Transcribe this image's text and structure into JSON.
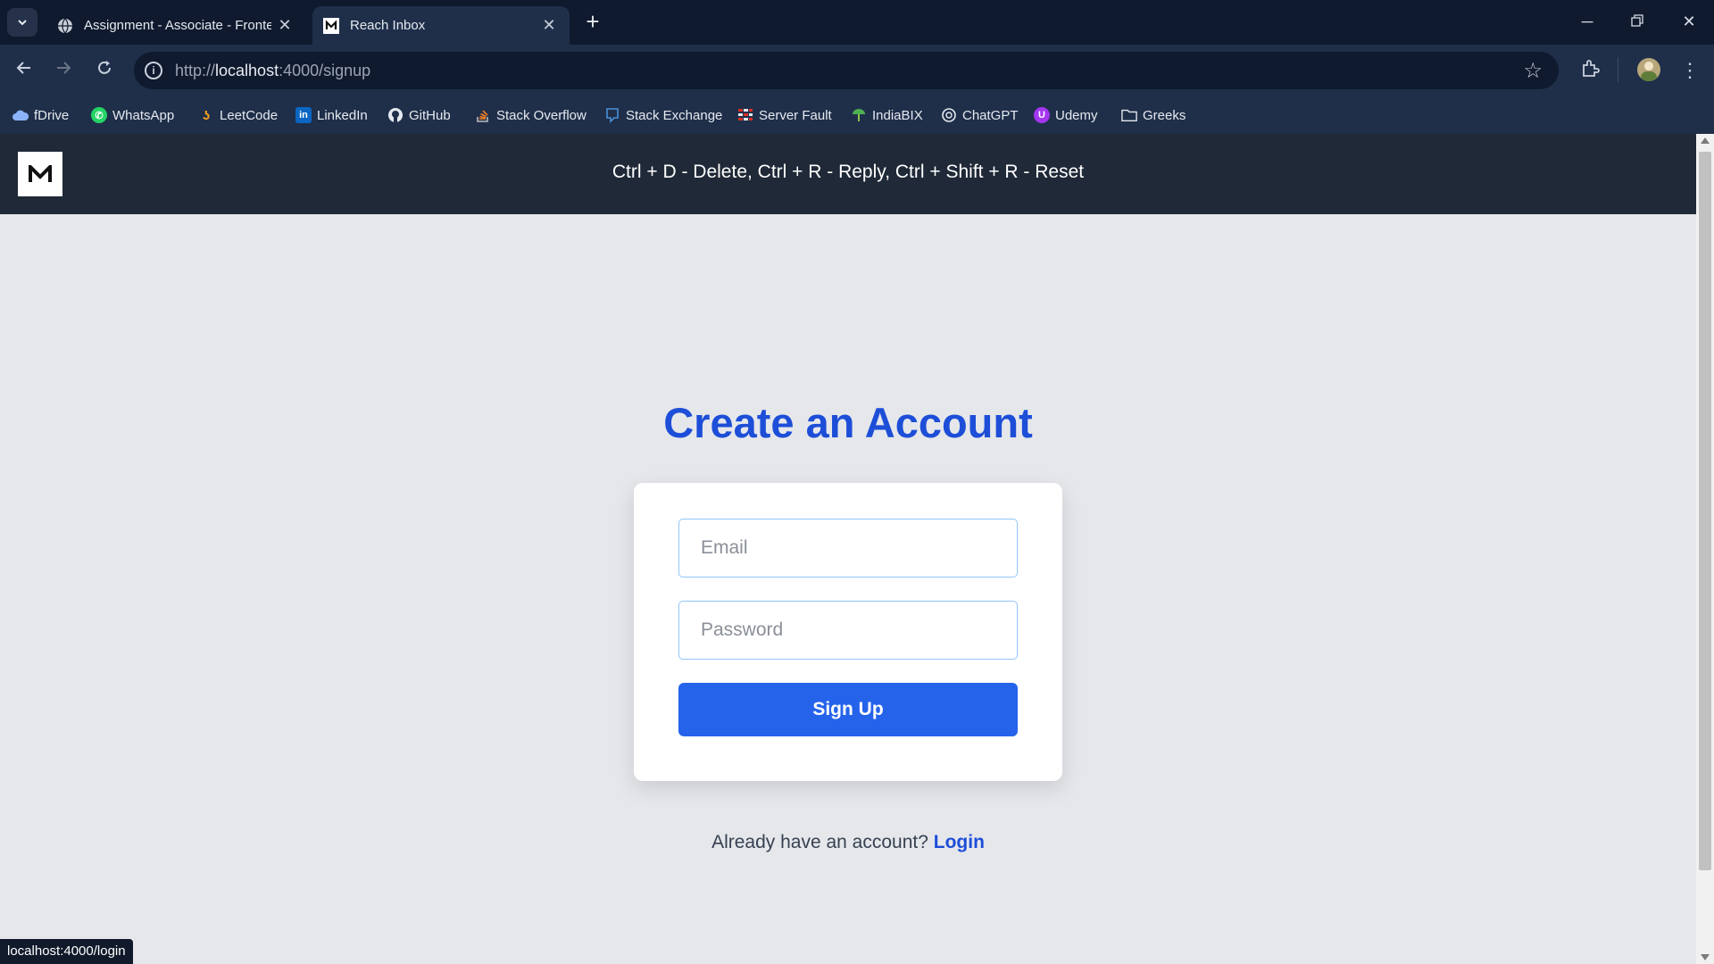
{
  "browser": {
    "tabs": [
      {
        "title": "Assignment - Associate - Frontend",
        "active": false
      },
      {
        "title": "Reach Inbox",
        "active": true
      }
    ],
    "url_scheme": "http://",
    "url_host": "localhost",
    "url_rest": ":4000/signup",
    "bookmarks": [
      {
        "label": "fDrive",
        "icon": "cloud-icon",
        "color": "#6ea8fe"
      },
      {
        "label": "WhatsApp",
        "icon": "whatsapp-icon",
        "color": "#25d366"
      },
      {
        "label": "LeetCode",
        "icon": "leetcode-icon",
        "color": "#f89f1b"
      },
      {
        "label": "LinkedIn",
        "icon": "linkedin-icon",
        "color": "#0a66c2"
      },
      {
        "label": "GitHub",
        "icon": "github-icon",
        "color": "#e6e9ef"
      },
      {
        "label": "Stack Overflow",
        "icon": "stackoverflow-icon",
        "color": "#f48024"
      },
      {
        "label": "Stack Exchange",
        "icon": "stackexchange-icon",
        "color": "#4a90d9"
      },
      {
        "label": "Server Fault",
        "icon": "serverfault-icon",
        "color": "#d93025"
      },
      {
        "label": "IndiaBIX",
        "icon": "indiabix-icon",
        "color": "#4caf50"
      },
      {
        "label": "ChatGPT",
        "icon": "chatgpt-icon",
        "color": "#e6e9ef"
      },
      {
        "label": "Udemy",
        "icon": "udemy-icon",
        "color": "#a435f0"
      },
      {
        "label": "Greeks",
        "icon": "folder-icon",
        "color": "#e6e9ef"
      }
    ]
  },
  "header": {
    "logo": "M",
    "shortcuts": "Ctrl + D - Delete, Ctrl + R - Reply, Ctrl + Shift + R - Reset"
  },
  "form": {
    "title": "Create an Account",
    "email_placeholder": "Email",
    "password_placeholder": "Password",
    "submit_label": "Sign Up",
    "already_text": "Already have an account?",
    "login_label": "Login"
  },
  "status_bar": "localhost:4000/login",
  "colors": {
    "accent": "#2563eb",
    "title": "#1d4ed8",
    "header_bg": "#1f2937",
    "page_bg": "#e5e7eb"
  }
}
